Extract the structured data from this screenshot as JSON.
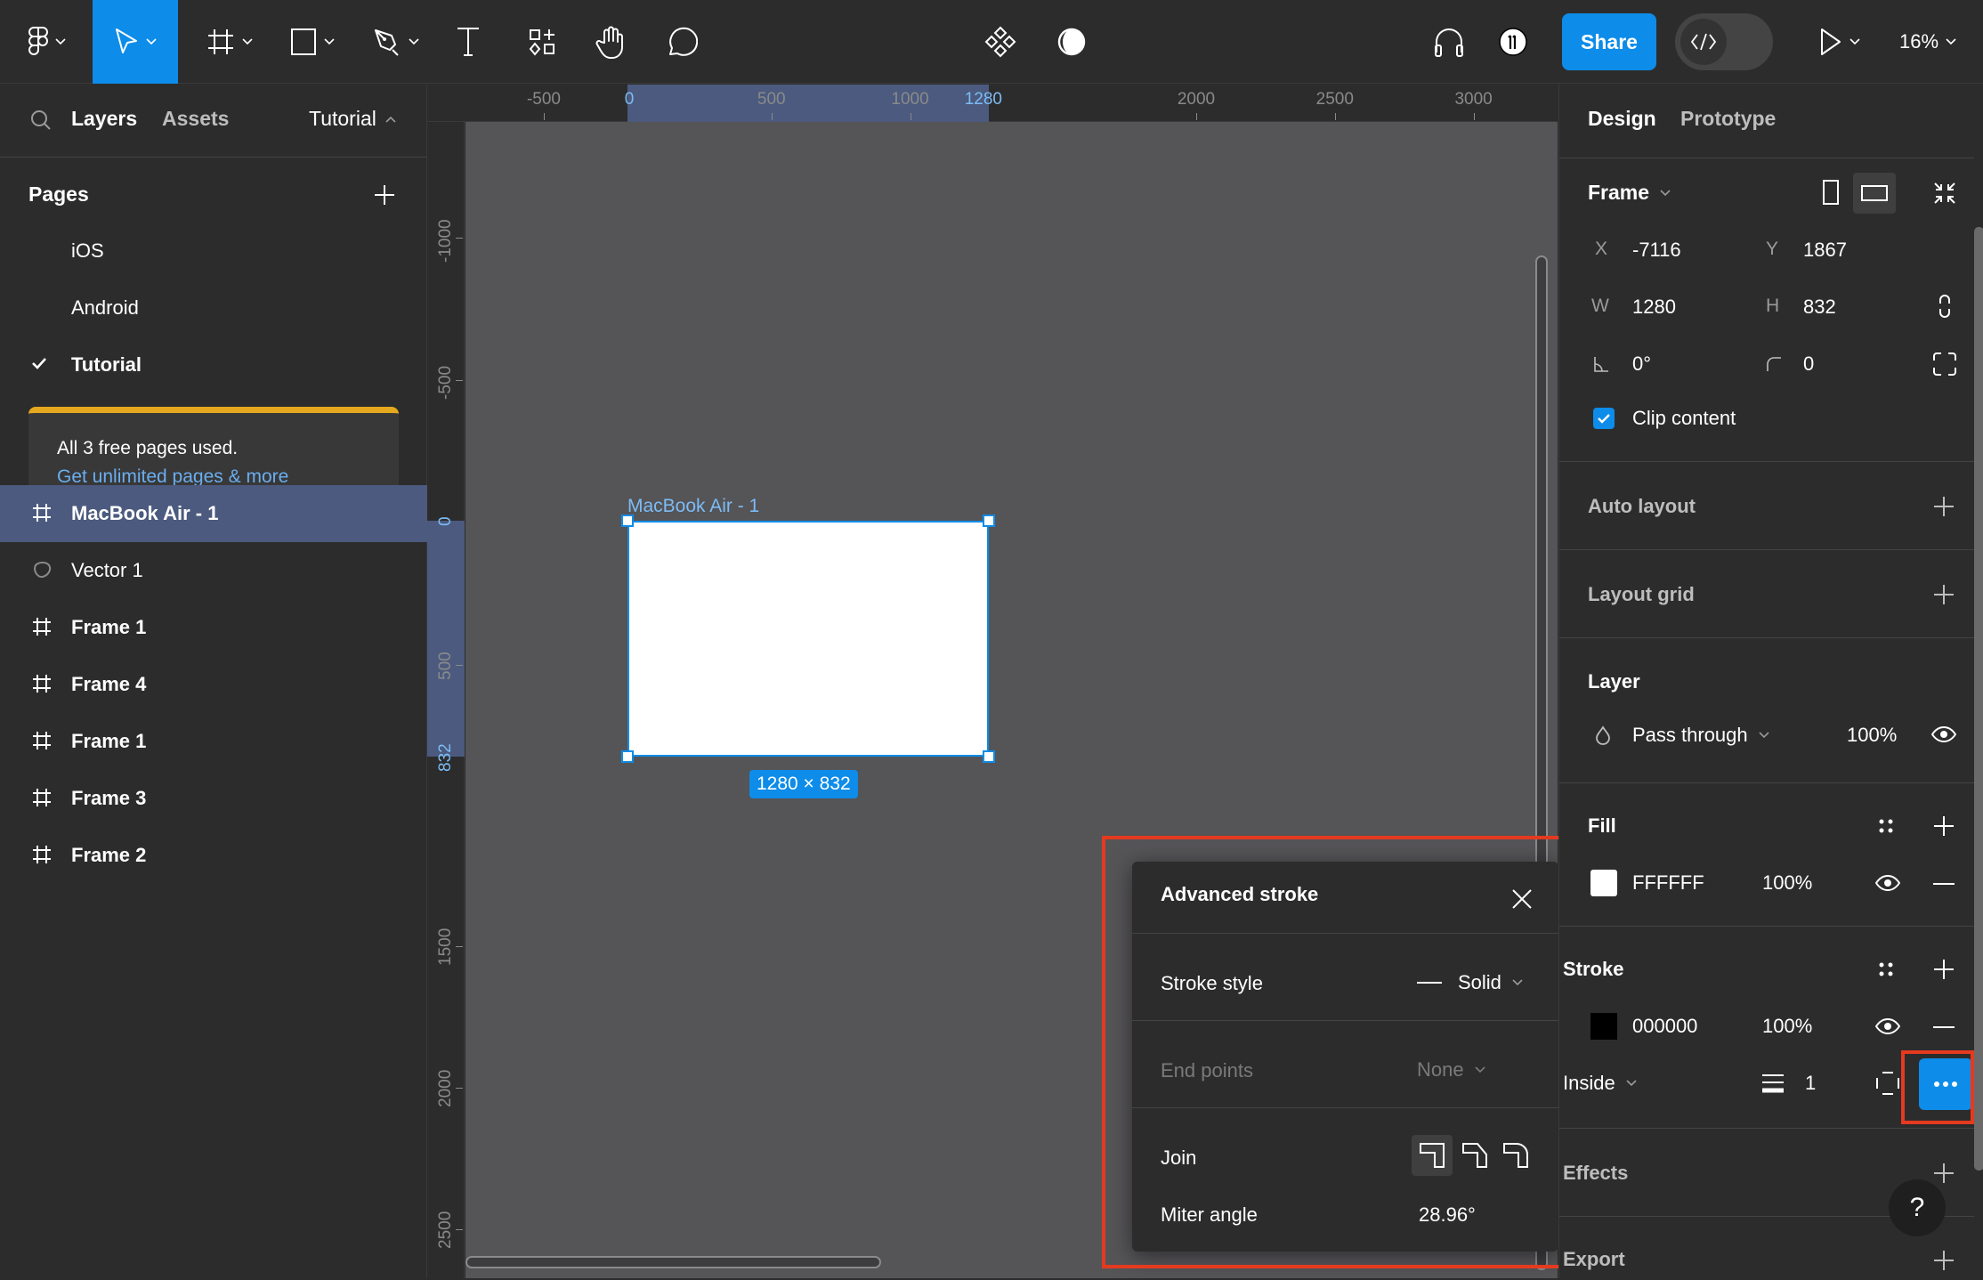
{
  "toolbar": {
    "tools": [
      {
        "name": "main-menu",
        "icon": "figma-logo-icon",
        "has_dropdown": true
      },
      {
        "name": "move",
        "icon": "move-arrow-icon",
        "has_dropdown": true,
        "active": true
      },
      {
        "name": "frame",
        "icon": "frame-hash-icon",
        "has_dropdown": true
      },
      {
        "name": "shape",
        "icon": "rectangle-icon",
        "has_dropdown": true
      },
      {
        "name": "pen",
        "icon": "pen-icon",
        "has_dropdown": true
      },
      {
        "name": "text",
        "icon": "text-icon",
        "has_dropdown": false
      },
      {
        "name": "resources",
        "icon": "resources-icon",
        "has_dropdown": false
      },
      {
        "name": "hand",
        "icon": "hand-icon",
        "has_dropdown": false
      },
      {
        "name": "comment",
        "icon": "comment-icon",
        "has_dropdown": false
      }
    ],
    "center_icons": [
      "components-icon",
      "contrast-icon"
    ],
    "share_label": "Share",
    "zoom_level": "16%",
    "accent_color": "#0d8ce9"
  },
  "left_panel": {
    "tabs": {
      "layers": "Layers",
      "assets": "Assets",
      "page_switcher": "Tutorial"
    },
    "pages_header": "Pages",
    "pages": [
      {
        "label": "iOS",
        "current": false
      },
      {
        "label": "Android",
        "current": false
      },
      {
        "label": "Tutorial",
        "current": true
      }
    ],
    "banner": {
      "message": "All 3 free pages used.",
      "link": "Get unlimited pages & more"
    },
    "layers": [
      {
        "label": "MacBook Air - 1",
        "type": "frame",
        "selected": true
      },
      {
        "label": "Vector 1",
        "type": "vector",
        "selected": false
      },
      {
        "label": "Frame 1",
        "type": "frame",
        "selected": false
      },
      {
        "label": "Frame 4",
        "type": "frame",
        "selected": false
      },
      {
        "label": "Frame 1",
        "type": "frame",
        "selected": false
      },
      {
        "label": "Frame 3",
        "type": "frame",
        "selected": false
      },
      {
        "label": "Frame 2",
        "type": "frame",
        "selected": false
      }
    ]
  },
  "rulers": {
    "top": [
      "-500",
      "0",
      "500",
      "1000",
      "1280",
      "2000",
      "2500",
      "3000"
    ],
    "left": [
      "-1000",
      "-500",
      "0",
      "500",
      "832",
      "1500",
      "2000",
      "2500"
    ]
  },
  "canvas": {
    "frame_name": "MacBook Air - 1",
    "frame_size": "1280 × 832"
  },
  "advanced_stroke": {
    "title": "Advanced stroke",
    "stroke_style_label": "Stroke style",
    "stroke_style_value": "Solid",
    "end_points_label": "End points",
    "end_points_value": "None",
    "join_label": "Join",
    "join_options": [
      "miter",
      "bevel",
      "round"
    ],
    "join_selected": "miter",
    "miter_angle_label": "Miter angle",
    "miter_angle_value": "28.96°"
  },
  "right_panel": {
    "tabs": {
      "design": "Design",
      "prototype": "Prototype"
    },
    "frame": {
      "title": "Frame",
      "x_label": "X",
      "x": "-7116",
      "y_label": "Y",
      "y": "1867",
      "w_label": "W",
      "w": "1280",
      "h_label": "H",
      "h": "832",
      "rotation": "0°",
      "radius": "0",
      "clip_content_label": "Clip content",
      "clip_content": true
    },
    "auto_layout": "Auto layout",
    "layout_grid": "Layout grid",
    "layer": {
      "title": "Layer",
      "blend_mode": "Pass through",
      "opacity": "100%"
    },
    "fill": {
      "title": "Fill",
      "color": "FFFFFF",
      "swatch": "#ffffff",
      "opacity": "100%"
    },
    "stroke": {
      "title": "Stroke",
      "color": "000000",
      "swatch": "#000000",
      "opacity": "100%",
      "position": "Inside",
      "weight": "1"
    },
    "effects": "Effects",
    "export": "Export",
    "help": "?"
  }
}
